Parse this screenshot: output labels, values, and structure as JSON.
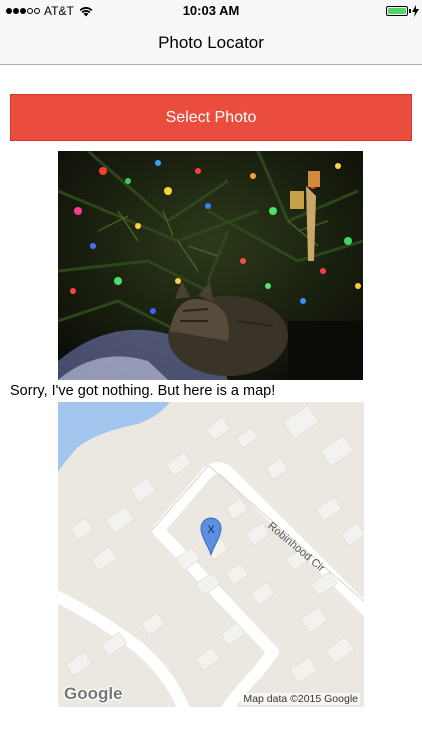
{
  "status_bar": {
    "carrier": "AT&T",
    "time": "10:03 AM",
    "signal_bars_filled": 3,
    "signal_bars_total": 5,
    "battery_level": 1.0,
    "battery_color": "#4cd964"
  },
  "nav": {
    "title": "Photo Locator"
  },
  "select_button": {
    "label": "Select Photo",
    "color": "#ea4c3d"
  },
  "photo": {
    "description_icon": "photo-image"
  },
  "message": "Sorry, I've got nothing. But here is a map!",
  "map": {
    "street_label": "Robinhood Cir",
    "pin_label": "X",
    "logo_text": "Google",
    "attribution": "Map data ©2015 Google"
  }
}
